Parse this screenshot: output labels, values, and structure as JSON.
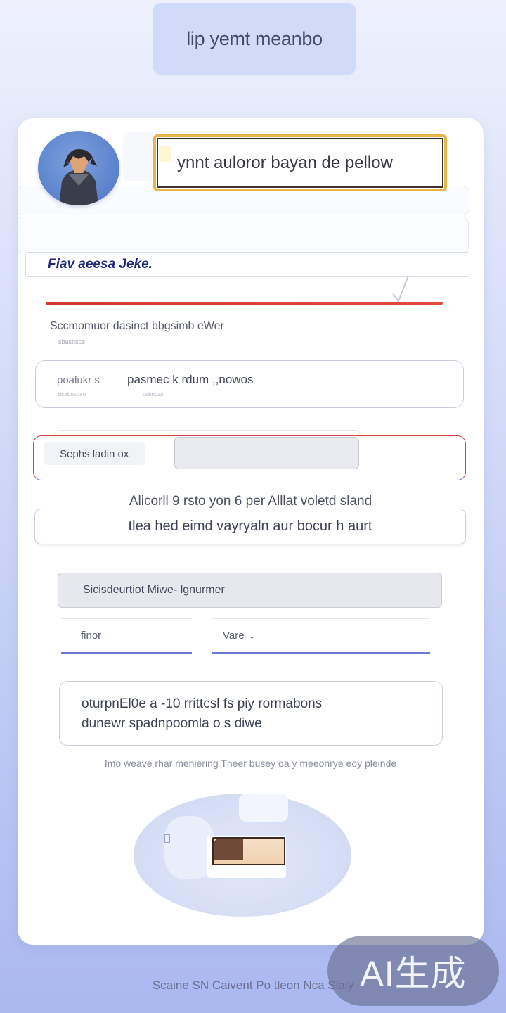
{
  "header": {
    "title": "lip yemt meanbo"
  },
  "profile": {
    "headline": "ynnt auloror bayan de pellow",
    "name": "Fiav aeesa Jeke.",
    "subtitle": "Sccmomuor dasinct bbgsimb eWer",
    "subtitle_hint": "sbasbsce"
  },
  "form": {
    "field_1": {
      "label": "poalukr s",
      "value": "pasmec k rdum ,,nowos",
      "hint_left": "bsabnsbeo",
      "hint_right": "csbnpas"
    },
    "search": {
      "chip_label": "Sephs ladin ox",
      "input_value": ""
    },
    "info_line": "Alicorll 9 rsto yon 6 per Alllat voletd sland",
    "field_2": {
      "value": "tlea hed eimd vayryaln aur bocur h aurt"
    },
    "field_3": {
      "value": "Sicisdeurtiot Miwe- lgnurmer"
    },
    "input_left": {
      "value": "finor"
    },
    "input_right": {
      "value": "Vare"
    },
    "message": {
      "line_1": "oturpnEl0e a -10 rrittcsl fs piy rormabons",
      "line_2": "dunewr spadnpoomla o s diwe"
    },
    "footnote": "Imo weave rhar meniering Theer busey oa y meeonrye eoy pleinde"
  },
  "footer": {
    "caption": "Scaine SN Caivent Po tleon Nca Slaly"
  },
  "badge": {
    "text": "AI生成"
  },
  "colors": {
    "accent_red": "#d8423c",
    "accent_blue": "#6b78d4",
    "highlight_gold": "#e7b54a",
    "name_text": "#1f2a7a"
  }
}
